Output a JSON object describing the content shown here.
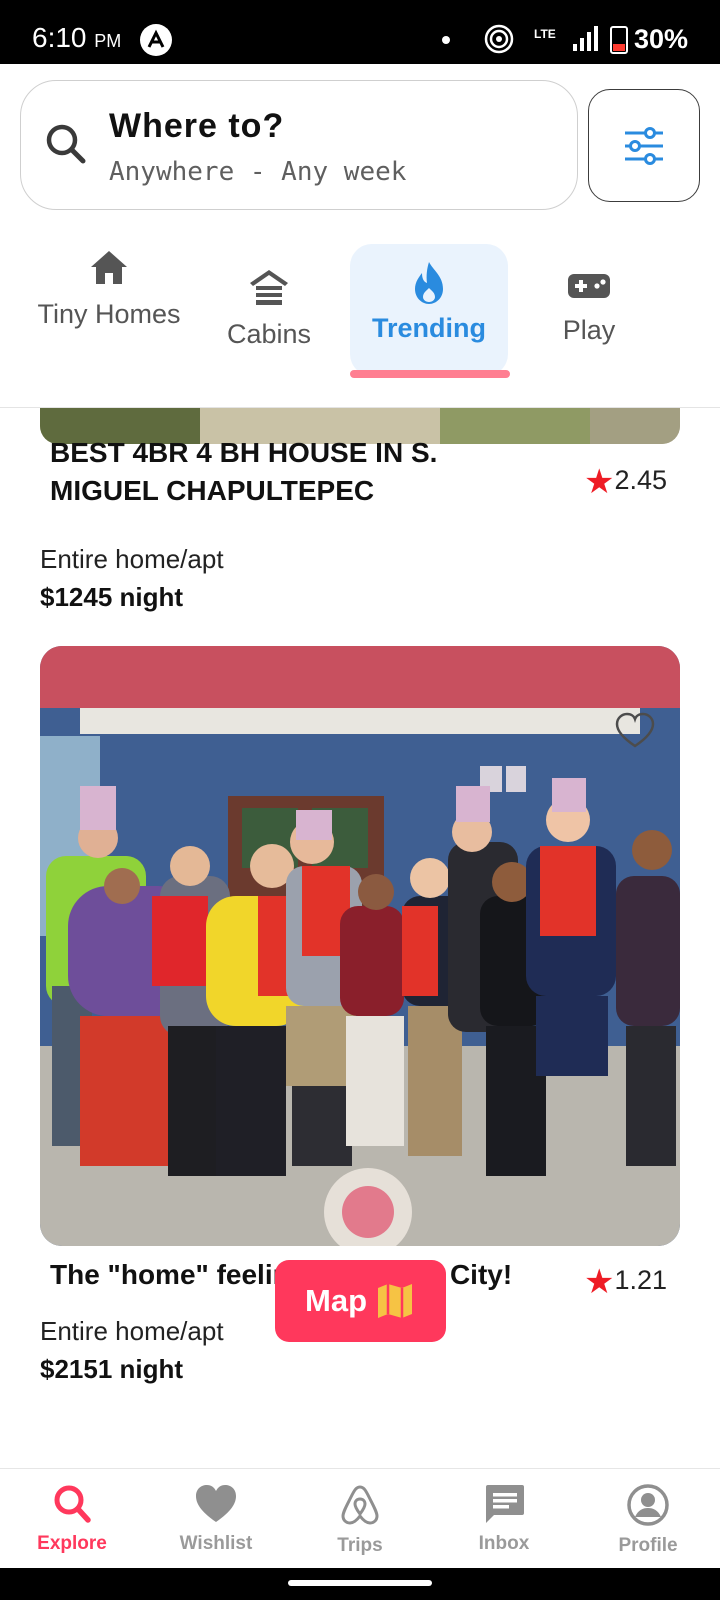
{
  "status_bar": {
    "time": "6:10",
    "ampm": "PM",
    "network": "LTE",
    "battery": "30%"
  },
  "search": {
    "title": "Where to?",
    "subtitle": "Anywhere - Any week"
  },
  "categories": [
    {
      "label": "Tiny Homes",
      "icon": "house-icon",
      "active": false
    },
    {
      "label": "Cabins",
      "icon": "cabin-icon",
      "active": false
    },
    {
      "label": "Trending",
      "icon": "flame-icon",
      "active": true
    },
    {
      "label": "Play",
      "icon": "gamepad-icon",
      "active": false
    }
  ],
  "listings": [
    {
      "title": "BEST 4BR 4 BH HOUSE IN S. MIGUEL CHAPULTEPEC",
      "rating": "2.45",
      "type": "Entire home/apt",
      "price": "$1245 night"
    },
    {
      "title": "The \"home\" feeling in Mexico City!",
      "rating": "1.21",
      "type": "Entire home/apt",
      "price": "$2151 night"
    }
  ],
  "map_button": {
    "label": "Map",
    "icon": "map-icon"
  },
  "bottom_nav": [
    {
      "label": "Explore",
      "icon": "search-icon",
      "active": true
    },
    {
      "label": "Wishlist",
      "icon": "heart-icon",
      "active": false
    },
    {
      "label": "Trips",
      "icon": "airbnb-logo-icon",
      "active": false
    },
    {
      "label": "Inbox",
      "icon": "message-icon",
      "active": false
    },
    {
      "label": "Profile",
      "icon": "user-icon",
      "active": false
    }
  ],
  "colors": {
    "brand": "#ff385c",
    "active_tab": "#2a8bdf",
    "star": "#ee1c25"
  }
}
